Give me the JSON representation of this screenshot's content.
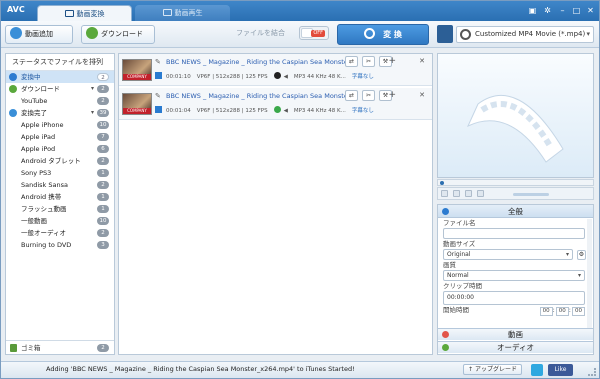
{
  "app": {
    "logo": "AVC"
  },
  "tabs": [
    {
      "label": "動画変換",
      "active": true
    },
    {
      "label": "動画再生",
      "active": false
    }
  ],
  "window_controls": [
    "minimize",
    "maximize",
    "close"
  ],
  "toolbar": {
    "add_video_label": "動画追加",
    "download_label": "ダウンロード",
    "merge_label": "ファイルを結合",
    "merge_state": "OFF",
    "convert_label": "変 換",
    "format_value": "Customized MP4 Movie (*.mp4)"
  },
  "sidebar": {
    "sort_label": "ステータスでファイルを排列",
    "items": [
      {
        "label": "変換中",
        "count": "2",
        "selected": true,
        "kind": "group"
      },
      {
        "label": "ダウンロード",
        "count": "2",
        "kind": "group"
      },
      {
        "label": "YouTube",
        "count": "2",
        "kind": "sub"
      },
      {
        "label": "変換完了",
        "count": "39",
        "kind": "group"
      },
      {
        "label": "Apple iPhone",
        "count": "10",
        "kind": "sub"
      },
      {
        "label": "Apple iPad",
        "count": "7",
        "kind": "sub"
      },
      {
        "label": "Apple iPod",
        "count": "6",
        "kind": "sub"
      },
      {
        "label": "Android タブレット",
        "count": "2",
        "kind": "sub"
      },
      {
        "label": "Sony PS3",
        "count": "1",
        "kind": "sub"
      },
      {
        "label": "Sandisk Sansa",
        "count": "2",
        "kind": "sub"
      },
      {
        "label": "Android 携帯",
        "count": "1",
        "kind": "sub"
      },
      {
        "label": "フラッシュ動画",
        "count": "1",
        "kind": "sub"
      },
      {
        "label": "一般動画",
        "count": "10",
        "kind": "sub"
      },
      {
        "label": "一般オーディオ",
        "count": "2",
        "kind": "sub"
      },
      {
        "label": "Burning to DVD",
        "count": "3",
        "kind": "sub"
      }
    ],
    "trash_label": "ゴミ箱",
    "trash_count": "2"
  },
  "files": [
    {
      "name": "BBC NEWS _ Magazine _ Riding the Caspian Sea Monster...",
      "duration": "00:01:10",
      "video_info": "VP6F | 512x288 | 125 FPS",
      "audio_info": "MP3 44 KHz 48 K...",
      "subtitle": "字幕なし",
      "thumb_tag": "COMPANY"
    },
    {
      "name": "BBC NEWS _ Magazine _ Riding the Caspian Sea Monster...",
      "duration": "00:01:04",
      "video_info": "VP6F | 512x288 | 125 FPS",
      "audio_info": "MP3 44 KHz 48 K...",
      "subtitle": "字幕なし",
      "thumb_tag": "COMPANY"
    }
  ],
  "settings": {
    "header": "全般",
    "filename_label": "ファイル名",
    "filename_value": "",
    "video_size_label": "動画サイズ",
    "video_size_value": "Original",
    "quality_label": "画質",
    "quality_value": "Normal",
    "clip_time_label": "クリップ時間",
    "clip_time_value": "00:00:00",
    "start_time_label": "開始時間",
    "start_time_values": [
      "00",
      "00",
      "00"
    ],
    "video_section": "動画",
    "audio_section": "オーディオ"
  },
  "status": {
    "message": "Adding 'BBC NEWS _ Magazine _ Riding the Caspian Sea Monster_x264.mp4' to iTunes Started!",
    "upgrade_label": "アップグレード",
    "like_label": "Like"
  },
  "colors": {
    "accent": "#2f78c2",
    "title_bar": "#2a6fb2",
    "selection": "#cfe3f6"
  }
}
